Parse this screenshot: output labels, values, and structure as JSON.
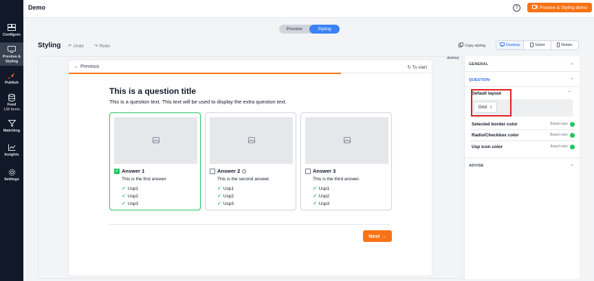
{
  "app": {
    "title": "Demo",
    "cta_label": "Preview & Styling demo",
    "help_symbol": "?"
  },
  "sidebar": {
    "items": [
      {
        "label": "Configure",
        "icon": "configure-icon"
      },
      {
        "label": "Preview & Styling",
        "icon": "monitor-icon",
        "active": true
      },
      {
        "label": "Publish",
        "icon": "rocket-icon"
      },
      {
        "label": "Feed",
        "sub": "128 items",
        "icon": "database-icon"
      },
      {
        "label": "Matching",
        "icon": "filter-icon"
      },
      {
        "label": "Insights",
        "icon": "chart-icon"
      },
      {
        "label": "Settings",
        "icon": "gear-icon"
      }
    ]
  },
  "mode_toggle": {
    "preview": "Preview",
    "styling": "Styling",
    "active": "Styling"
  },
  "toolbar": {
    "title": "Styling",
    "undo": "Undo",
    "redo": "Redo",
    "copy_styling": "Copy styling",
    "devices": [
      "Desktop",
      "Tablet",
      "Mobile"
    ],
    "active_device": "Desktop",
    "viewport_tag": "desktop"
  },
  "question": {
    "prev_label": "← Previous",
    "restart_label": "To start",
    "progress_fraction": 0.75,
    "title": "This is a question title",
    "text": "This is a question text. This text will be used to display the extra question text.",
    "answers": [
      {
        "label": "Answer 1",
        "desc": "This is the first answer.",
        "usps": [
          "Usp1",
          "Usp2",
          "Usp3"
        ],
        "selected": true,
        "info": false
      },
      {
        "label": "Answer 2",
        "desc": "This is the second answer.",
        "usps": [
          "Usp1",
          "Usp2",
          "Usp3"
        ],
        "selected": false,
        "info": true
      },
      {
        "label": "Answer 3",
        "desc": "This is the third answer.",
        "usps": [
          "Usp1",
          "Usp2",
          "Usp3"
        ],
        "selected": false,
        "info": false
      }
    ],
    "next_label": "Next →"
  },
  "panel": {
    "general": "GENERAL",
    "question": "QUESTION",
    "advise": "ADVISE",
    "default_layout_label": "Default layout",
    "layout_value": "Grid",
    "color_rows": [
      {
        "label": "Selected border color",
        "value": "Brand color"
      },
      {
        "label": "Radio/Checkbox color",
        "value": "Brand color"
      },
      {
        "label": "Usp icon color",
        "value": "Brand color"
      }
    ]
  },
  "colors": {
    "accent": "#f97316",
    "primary": "#3b82f6",
    "success": "#22c55e",
    "highlight": "#e11d1d"
  }
}
